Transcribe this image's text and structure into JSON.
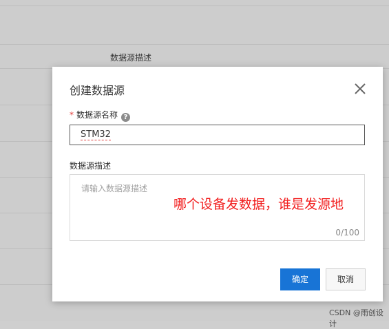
{
  "background": {
    "column_header": "数据源描述"
  },
  "modal": {
    "title": "创建数据源",
    "name_field": {
      "required_mark": "*",
      "label": "数据源名称",
      "help": "?",
      "value": "STM32"
    },
    "desc_field": {
      "label": "数据源描述",
      "placeholder": "请输入数据源描述",
      "counter": "0/100"
    },
    "annotation": "哪个设备发数据，谁是发源地",
    "ok_label": "确定",
    "cancel_label": "取消"
  },
  "watermark": "CSDN @雨创设计",
  "colors": {
    "primary": "#1874d6",
    "annotation": "#f21f1f",
    "required": "#e23c39"
  }
}
